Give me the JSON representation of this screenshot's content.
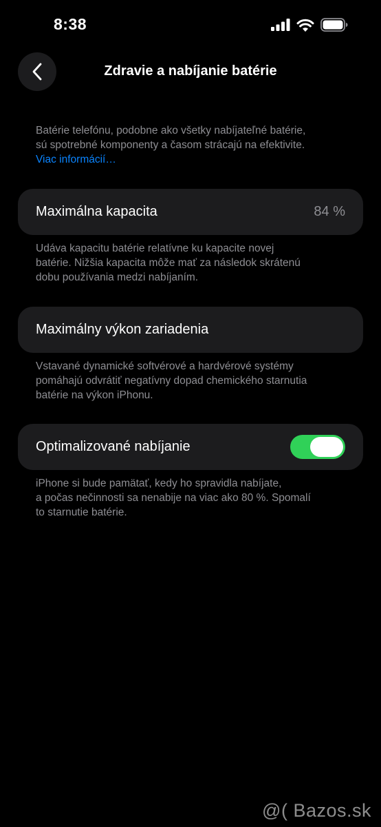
{
  "status_bar": {
    "time": "8:38",
    "icons": [
      "signal-icon",
      "wifi-icon",
      "battery-icon"
    ]
  },
  "nav": {
    "back_icon": "chevron-left-icon",
    "title": "Zdravie a nabíjanie batérie"
  },
  "intro": {
    "text_lines": [
      "Batérie telefónu, podobne ako všetky nabíjateľné batérie,",
      "sú spotrebné komponenty a časom strácajú na efektivite."
    ],
    "link": "Viac informácií…"
  },
  "max_capacity": {
    "label": "Maximálna kapacita",
    "value": "84 %",
    "footnote_lines": [
      "Udáva kapacitu batérie relatívne ku kapacite novej",
      "batérie. Nižšia kapacita môže mať za následok skrátenú",
      "dobu používania medzi nabíjaním."
    ]
  },
  "peak_performance": {
    "label": "Maximálny výkon zariadenia",
    "footnote_lines": [
      "Vstavané dynamické softvérové a hardvérové systémy",
      "pomáhajú odvrátiť negatívny dopad chemického starnutia",
      "batérie na výkon iPhonu."
    ]
  },
  "optimized_charging": {
    "label": "Optimalizované nabíjanie",
    "enabled": true,
    "footnote_lines": [
      "iPhone si bude pamätať, kedy ho spravidla nabíjate,",
      "a počas nečinnosti sa nenabije na viac ako 80 %. Spomalí",
      "to starnutie batérie."
    ]
  },
  "watermark": "@( Bazos.sk",
  "colors": {
    "background": "#000000",
    "card": "#1c1c1e",
    "secondary_text": "#8e8e93",
    "link": "#0a84ff",
    "toggle_on": "#30d158"
  }
}
